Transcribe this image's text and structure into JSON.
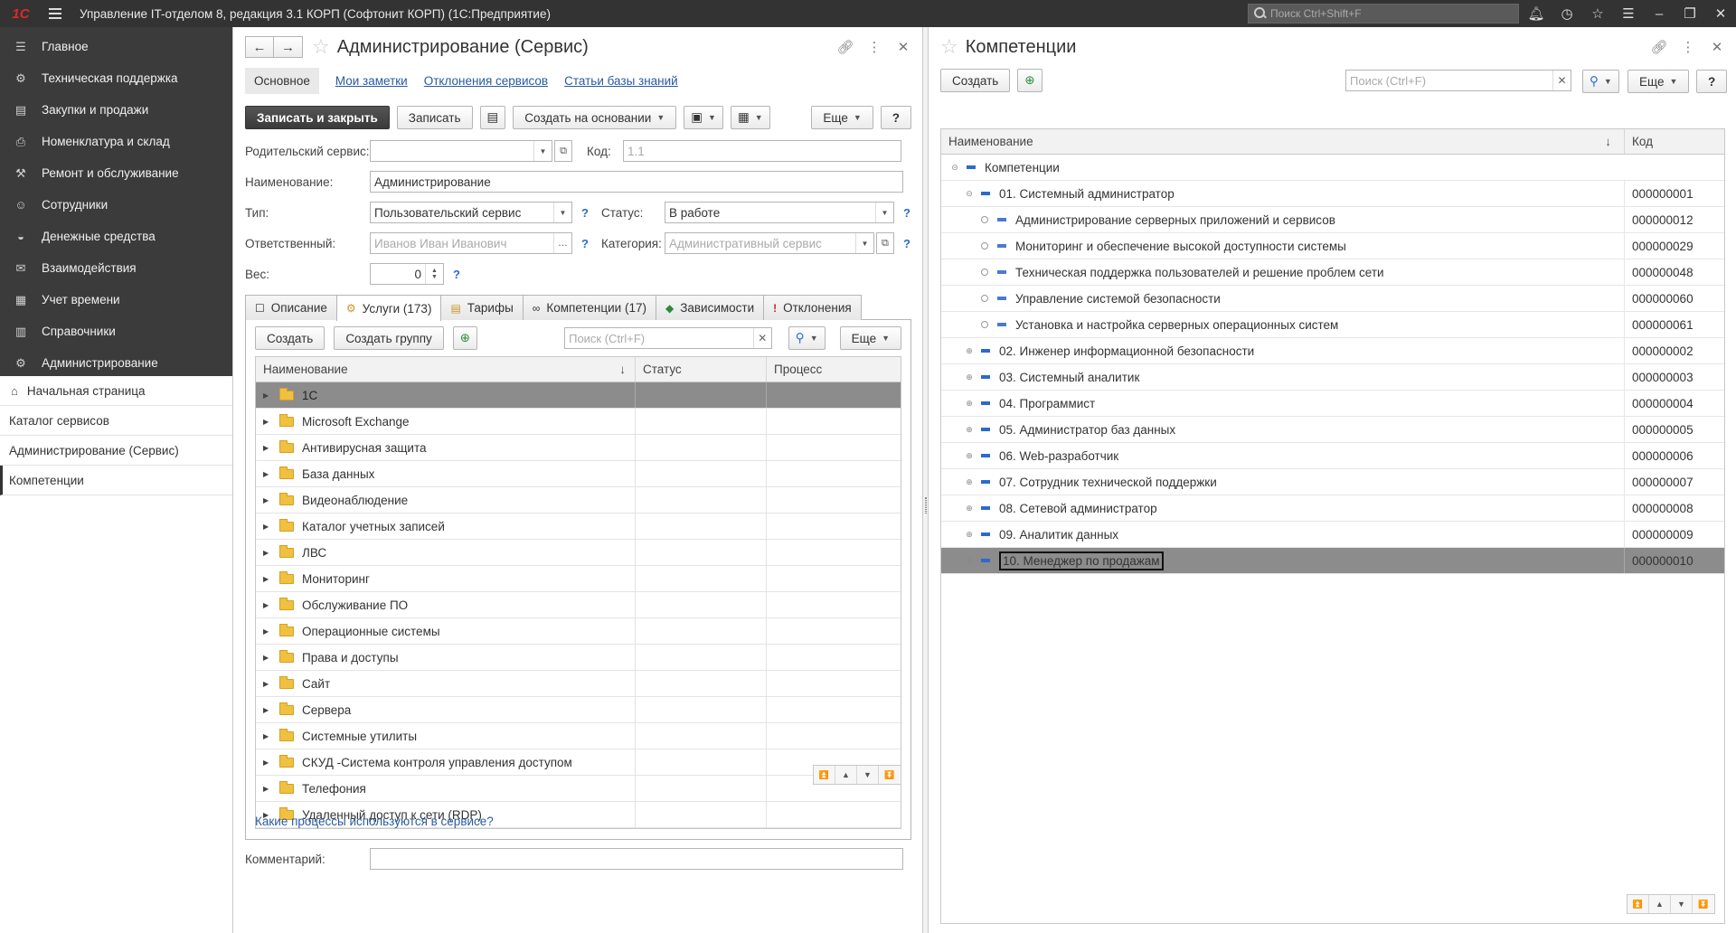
{
  "app": {
    "title": "Управление IT-отделом 8, редакция 3.1 КОРП (Софтонит КОРП)  (1С:Предприятие)",
    "search_placeholder": "Поиск Ctrl+Shift+F",
    "logo": "1С"
  },
  "sidebar": {
    "sections": [
      {
        "label": "Главное",
        "icon": "menu-lines-icon"
      },
      {
        "label": "Техническая поддержка",
        "icon": "gear-icon"
      },
      {
        "label": "Закупки и продажи",
        "icon": "truck-icon"
      },
      {
        "label": "Номенклатура и склад",
        "icon": "printer-icon"
      },
      {
        "label": "Ремонт и обслуживание",
        "icon": "wrench-icon"
      },
      {
        "label": "Сотрудники",
        "icon": "people-icon"
      },
      {
        "label": "Денежные средства",
        "icon": "bag-icon"
      },
      {
        "label": "Взаимодействия",
        "icon": "mail-icon"
      },
      {
        "label": "Учет времени",
        "icon": "calendar-icon"
      },
      {
        "label": "Справочники",
        "icon": "book-icon"
      },
      {
        "label": "Администрирование",
        "icon": "settings-icon"
      }
    ],
    "open_windows": [
      {
        "label": "Начальная страница"
      },
      {
        "label": "Каталог сервисов"
      },
      {
        "label": "Администрирование (Сервис)"
      },
      {
        "label": "Компетенции"
      }
    ]
  },
  "left_form": {
    "title": "Администрирование (Сервис)",
    "tabs": {
      "main": "Основное",
      "links": [
        "Мои заметки",
        "Отклонения сервисов",
        "Статьи базы знаний"
      ]
    },
    "toolbar": {
      "save_close": "Записать и закрыть",
      "save": "Записать",
      "create_based": "Создать на основании",
      "more": "Еще",
      "help": "?"
    },
    "fields": {
      "parent_label": "Родительский сервис:",
      "parent_value": "",
      "code_label": "Код:",
      "code_value": "1.1",
      "name_label": "Наименование:",
      "name_value": "Администрирование",
      "type_label": "Тип:",
      "type_value": "Пользовательский сервис",
      "status_label": "Статус:",
      "status_value": "В работе",
      "resp_label": "Ответственный:",
      "resp_value": "Иванов Иван Иванович",
      "cat_label": "Категория:",
      "cat_value": "Административный сервис",
      "weight_label": "Вес:",
      "weight_value": "0",
      "comment_label": "Комментарий:",
      "comment_value": ""
    },
    "subtabs": [
      "Описание",
      "Услуги (173)",
      "Тарифы",
      "Компетенции (17)",
      "Зависимости",
      "Отклонения"
    ],
    "inner_toolbar": {
      "create": "Создать",
      "create_group": "Создать группу",
      "search_placeholder": "Поиск (Ctrl+F)",
      "more": "Еще"
    },
    "grid": {
      "columns": [
        "Наименование",
        "Статус",
        "Процесс"
      ],
      "rows": [
        "1С",
        "Microsoft Exchange",
        "Антивирусная защита",
        "База данных",
        "Видеонаблюдение",
        "Каталог учетных записей",
        "ЛВС",
        "Мониторинг",
        "Обслуживание ПО",
        "Операционные системы",
        "Права и доступы",
        "Сайт",
        "Сервера",
        "Системные утилиты",
        "СКУД -Система контроля управления доступом",
        "Телефония",
        "Удаленный доступ к сети (RDP)"
      ]
    },
    "process_link": "Какие процессы используются в сервисе?"
  },
  "right_form": {
    "title": "Компетенции",
    "toolbar": {
      "create": "Создать",
      "search_placeholder": "Поиск (Ctrl+F)",
      "more": "Еще",
      "help": "?"
    },
    "columns": [
      "Наименование",
      "Код"
    ],
    "root": "Компетенции",
    "rows": [
      {
        "name": "01. Системный администратор",
        "code": "000000001",
        "level": 1,
        "kind": "group-open"
      },
      {
        "name": "Администрирование серверных приложений и сервисов",
        "code": "000000012",
        "level": 2,
        "kind": "item"
      },
      {
        "name": "Мониторинг и обеспечение высокой доступности системы",
        "code": "000000029",
        "level": 2,
        "kind": "item"
      },
      {
        "name": "Техническая поддержка пользователей и решение проблем сети",
        "code": "000000048",
        "level": 2,
        "kind": "item"
      },
      {
        "name": "Управление системой безопасности",
        "code": "000000060",
        "level": 2,
        "kind": "item"
      },
      {
        "name": "Установка и настройка серверных операционных систем",
        "code": "000000061",
        "level": 2,
        "kind": "item"
      },
      {
        "name": "02. Инженер информационной безопасности",
        "code": "000000002",
        "level": 1,
        "kind": "group"
      },
      {
        "name": "03. Системный аналитик",
        "code": "000000003",
        "level": 1,
        "kind": "group"
      },
      {
        "name": "04. Программист",
        "code": "000000004",
        "level": 1,
        "kind": "group"
      },
      {
        "name": "05. Администратор баз данных",
        "code": "000000005",
        "level": 1,
        "kind": "group"
      },
      {
        "name": "06. Web-разработчик",
        "code": "000000006",
        "level": 1,
        "kind": "group"
      },
      {
        "name": "07. Сотрудник технической поддержки",
        "code": "000000007",
        "level": 1,
        "kind": "group"
      },
      {
        "name": "08. Сетевой администратор",
        "code": "000000008",
        "level": 1,
        "kind": "group"
      },
      {
        "name": "09. Аналитик данных",
        "code": "000000009",
        "level": 1,
        "kind": "group"
      },
      {
        "name": "10. Менеджер по продажам",
        "code": "000000010",
        "level": 1,
        "kind": "group",
        "selected": true
      }
    ]
  }
}
